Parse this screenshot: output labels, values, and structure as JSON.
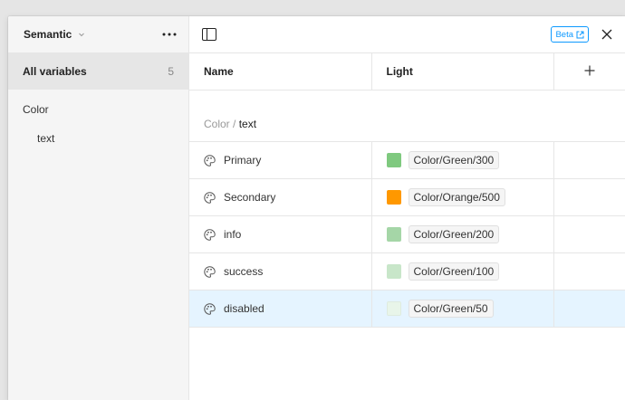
{
  "sidebar": {
    "collection_name": "Semantic",
    "all_variables": {
      "label": "All variables",
      "count": "5"
    },
    "groups": [
      {
        "label": "Color",
        "subgroups": [
          {
            "label": "text"
          }
        ]
      }
    ]
  },
  "header": {
    "beta_label": "Beta"
  },
  "table": {
    "columns": [
      {
        "label": "Name"
      },
      {
        "label": "Light"
      }
    ],
    "path": {
      "group": "Color",
      "separator": " / ",
      "current": "text"
    },
    "rows": [
      {
        "name": "Primary",
        "value": "Color/Green/300",
        "color": "#7fc97f",
        "selected": false
      },
      {
        "name": "Secondary",
        "value": "Color/Orange/500",
        "color": "#ff9800",
        "selected": false
      },
      {
        "name": "info",
        "value": "Color/Green/200",
        "color": "#a5d6a7",
        "selected": false
      },
      {
        "name": "success",
        "value": "Color/Green/100",
        "color": "#c8e6c9",
        "selected": false
      },
      {
        "name": "disabled",
        "value": "Color/Green/50",
        "color": "#e8f5e9",
        "selected": true
      }
    ]
  },
  "colors": {
    "accent": "#0d99ff",
    "selected_row_bg": "#e5f4ff",
    "sidebar_bg": "#f5f5f5"
  },
  "icons": {
    "row_icon": "palette-icon",
    "collection_chevron": "chevron-down-icon",
    "more": "more-horizontal-icon",
    "toggle_sidebar": "sidebar-toggle-icon",
    "add_mode": "plus-icon",
    "close": "close-icon",
    "beta_external": "external-link-icon"
  }
}
